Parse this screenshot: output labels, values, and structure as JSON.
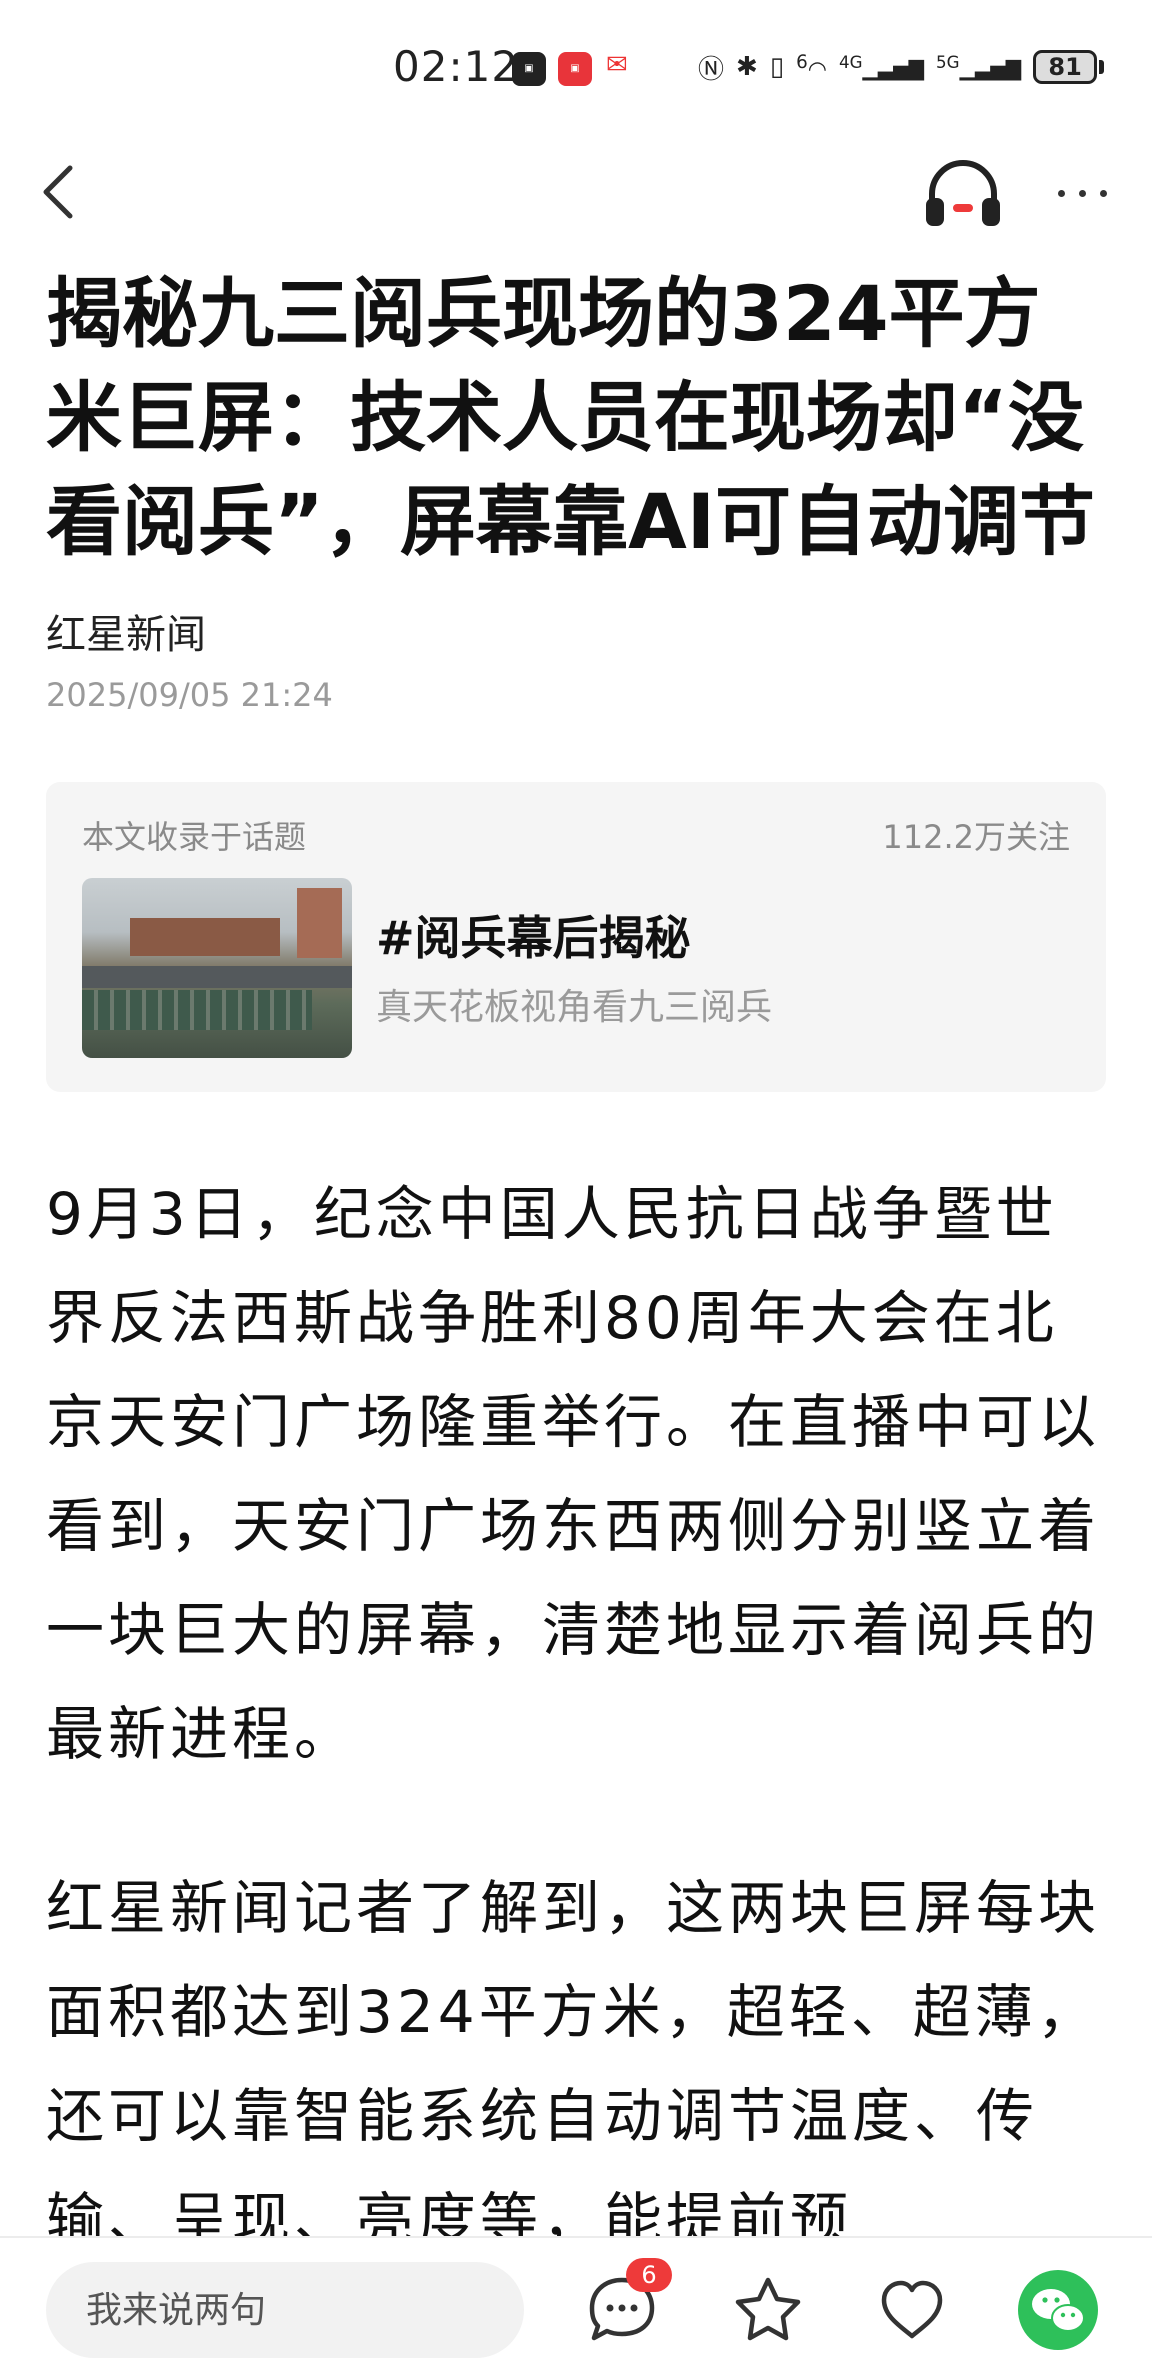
{
  "status_bar": {
    "time": "02:12",
    "battery": "81",
    "signal_labels": [
      "6",
      "4G",
      "5G"
    ]
  },
  "article": {
    "title": "揭秘九三阅兵现场的324平方米巨屏：技术人员在现场却“没看阅兵”，屏幕靠AI可自动调节",
    "source": "红星新闻",
    "date": "2025/09/05 21:24"
  },
  "topic": {
    "label": "本文收录于话题",
    "followers": "112.2万关注",
    "name": "#阅兵幕后揭秘",
    "description": "真天花板视角看九三阅兵"
  },
  "body": {
    "paragraphs": [
      "9月3日，纪念中国人民抗日战争暨世界反法西斯战争胜利80周年大会在北京天安门广场隆重举行。在直播中可以看到，天安门广场东西两侧分别竖立着一块巨大的屏幕，清楚地显示着阅兵的最新进程。",
      "红星新闻记者了解到，这两块巨屏每块面积都达到324平方米，超轻、超薄，还可以靠智能系统自动调节温度、传输、呈现、亮度等，能提前预"
    ]
  },
  "bottom_bar": {
    "comment_placeholder": "我来说两句",
    "comment_count": "6"
  },
  "colors": {
    "badge": "#ee3a3a",
    "wechat": "#2ec05a",
    "card_bg": "#f5f5f5",
    "muted_text": "#9a9a9a"
  },
  "icons": [
    "back-icon",
    "headphone-icon",
    "more-icon",
    "comment-icon",
    "star-icon",
    "heart-icon",
    "wechat-icon"
  ]
}
